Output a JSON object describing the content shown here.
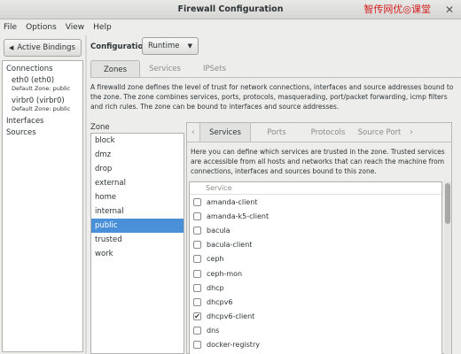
{
  "window": {
    "title": "Firewall Configuration",
    "watermark": "智传网优◎课堂",
    "close_glyph": "✕"
  },
  "menu": [
    "File",
    "Options",
    "View",
    "Help"
  ],
  "bindings": {
    "toggle_label": "Active Bindings",
    "items": [
      {
        "type": "header",
        "label": "Connections"
      },
      {
        "type": "conn",
        "name": "eth0 (eth0)",
        "zone": "Default Zone: public"
      },
      {
        "type": "conn",
        "name": "virbr0 (virbr0)",
        "zone": "Default Zone: public"
      },
      {
        "type": "header",
        "label": "Interfaces"
      },
      {
        "type": "header",
        "label": "Sources"
      }
    ]
  },
  "configuration": {
    "label": "Configuration:",
    "value": "Runtime"
  },
  "main_tabs": [
    {
      "label": "Zones",
      "active": true
    },
    {
      "label": "Services",
      "active": false
    },
    {
      "label": "IPSets",
      "active": false
    }
  ],
  "zone_description": "A firewalld zone defines the level of trust for network connections, interfaces and source addresses bound to the zone. The zone combines services, ports, protocols, masquerading, port/packet forwarding, icmp filters and rich rules. The zone can be bound to interfaces and source addresses.",
  "zone_header": "Zone",
  "zones": [
    {
      "name": "block",
      "selected": false
    },
    {
      "name": "dmz",
      "selected": false
    },
    {
      "name": "drop",
      "selected": false
    },
    {
      "name": "external",
      "selected": false
    },
    {
      "name": "home",
      "selected": false
    },
    {
      "name": "internal",
      "selected": false
    },
    {
      "name": "public",
      "selected": true
    },
    {
      "name": "trusted",
      "selected": false
    },
    {
      "name": "work",
      "selected": false
    }
  ],
  "service_tabs": [
    {
      "label": "Services",
      "active": true
    },
    {
      "label": "Ports",
      "active": false
    },
    {
      "label": "Protocols",
      "active": false
    },
    {
      "label": "Source Port",
      "active": false
    }
  ],
  "service_description": "Here you can define which services are trusted in the zone. Trusted services are accessible from all hosts and networks that can reach the machine from connections, interfaces and sources bound to this zone.",
  "service_header": "Service",
  "services": [
    {
      "name": "amanda-client",
      "checked": false
    },
    {
      "name": "amanda-k5-client",
      "checked": false
    },
    {
      "name": "bacula",
      "checked": false
    },
    {
      "name": "bacula-client",
      "checked": false
    },
    {
      "name": "ceph",
      "checked": false
    },
    {
      "name": "ceph-mon",
      "checked": false
    },
    {
      "name": "dhcp",
      "checked": false
    },
    {
      "name": "dhcpv6",
      "checked": false
    },
    {
      "name": "dhcpv6-client",
      "checked": true
    },
    {
      "name": "dns",
      "checked": false
    },
    {
      "name": "docker-registry",
      "checked": false
    }
  ],
  "colors": {
    "selection": "#4a90d9",
    "watermark": "#d41c1c"
  }
}
